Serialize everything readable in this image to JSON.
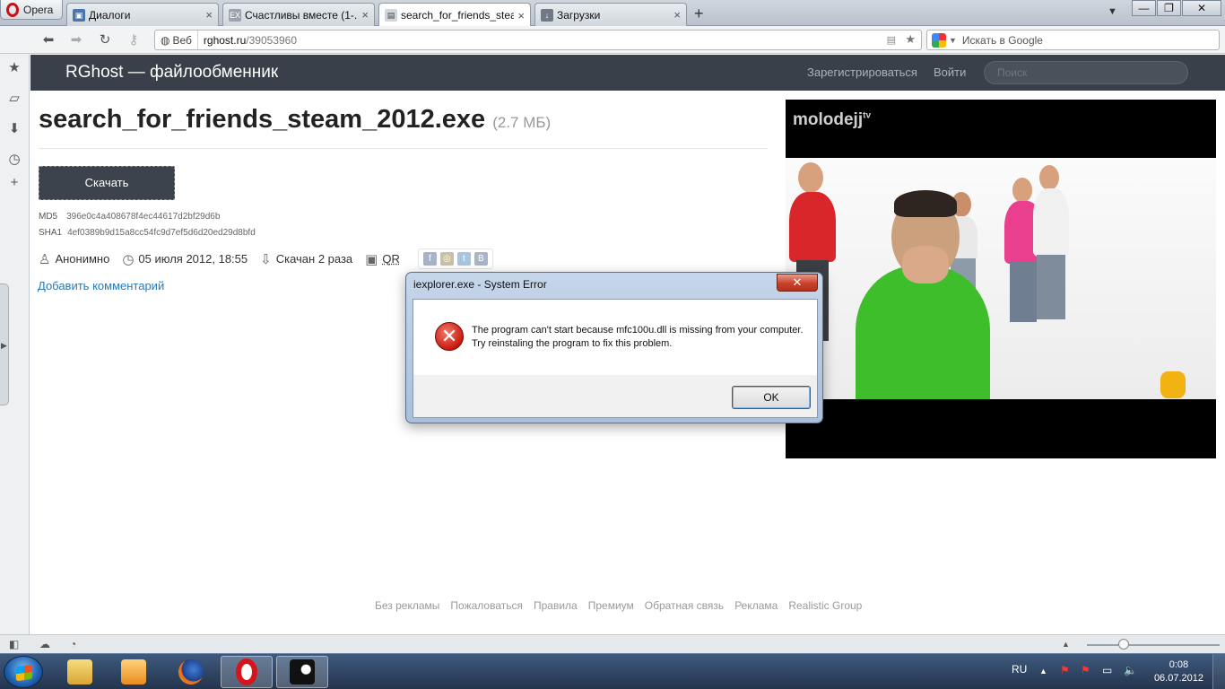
{
  "browser": {
    "menu_label": "Opera",
    "tabs": [
      {
        "title": "Диалоги",
        "favicon": "vk-icon"
      },
      {
        "title": "Счастливы вместе (1-...",
        "favicon": "ex-icon"
      },
      {
        "title": "search_for_friends_stea...",
        "favicon": "file-icon",
        "active": true
      },
      {
        "title": "Загрузки",
        "favicon": "downloads-icon"
      }
    ],
    "address": {
      "badge": "Веб",
      "host": "rghost.ru",
      "path": "/39053960"
    },
    "search": {
      "placeholder": "Искать в Google"
    }
  },
  "site": {
    "brand": "RGhost — файлообменник",
    "register_link": "Зарегистрироваться",
    "login_link": "Войти",
    "search_placeholder": "Поиск"
  },
  "file": {
    "name": "search_for_friends_steam_2012.exe",
    "size": "(2.7 МБ)",
    "download_label": "Скачать",
    "md5_label": "MD5",
    "md5": "396e0c4a408678f4ec44617d2bf29d6b",
    "sha1_label": "SHA1",
    "sha1": "4ef0389b9d15a8cc54fc9d7ef5d6d20ed29d8bfd",
    "uploader": "Анонимно",
    "date": "05 июля 2012, 18:55",
    "downloads": "Скачан 2 раза",
    "qr_label": "QR",
    "add_comment": "Добавить комментарий"
  },
  "video": {
    "logo": "molodejj",
    "logo_sup": "tv"
  },
  "footer": {
    "links": [
      "Без рекламы",
      "Пожаловаться",
      "Правила",
      "Премиум",
      "Обратная связь",
      "Реклама",
      "Realistic Group"
    ]
  },
  "dialog": {
    "title": "iexplorer.exe - System Error",
    "message": "The program can't start because mfc100u.dll is missing from your computer. Try reinstaling the program to fix this problem.",
    "ok_label": "OK"
  },
  "taskbar": {
    "language": "RU",
    "time": "0:08",
    "date": "06.07.2012"
  },
  "colors": {
    "header_bg": "#3a4049",
    "link": "#2a7ab3",
    "error_red": "#c81b0e"
  }
}
